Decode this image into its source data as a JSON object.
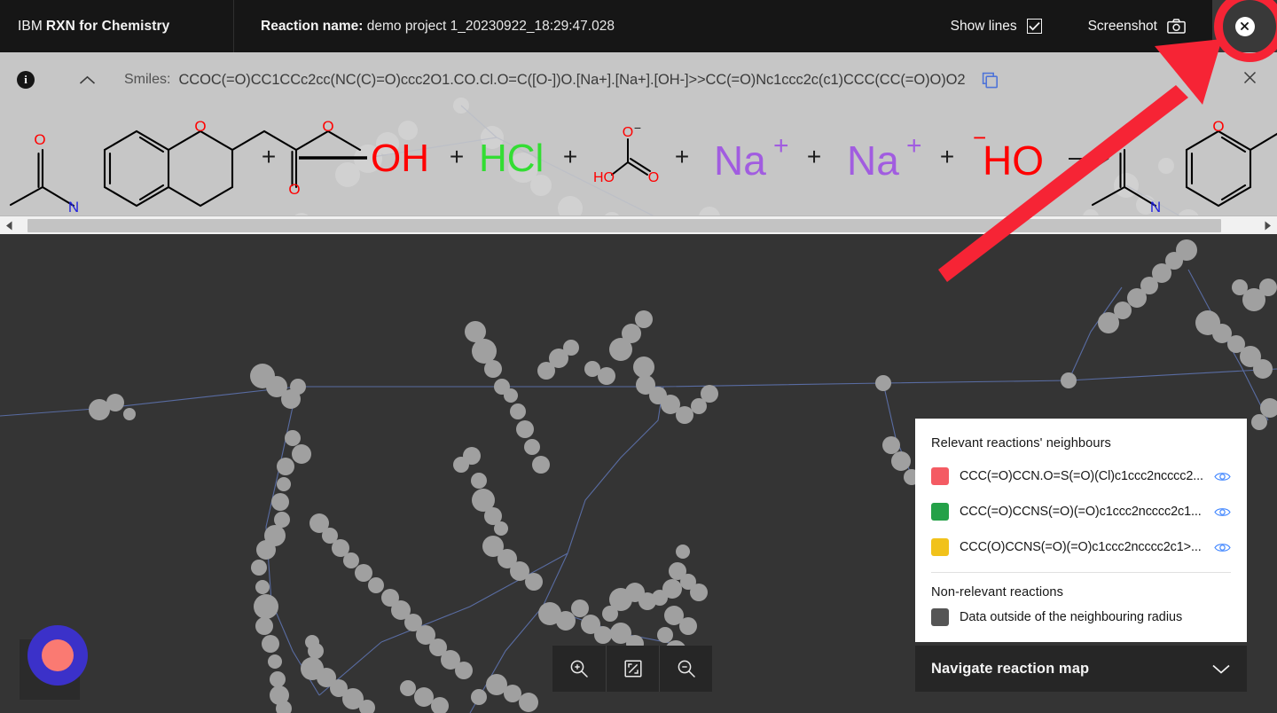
{
  "header": {
    "brand_light": "IBM",
    "brand_bold": "RXN for Chemistry",
    "reaction_label": "Reaction name:",
    "reaction_value": "demo project 1_20230922_18:29:47.028",
    "show_lines_label": "Show lines",
    "show_lines_checked": true,
    "screenshot_label": "Screenshot",
    "checkbox_icon": "check-icon",
    "camera_icon": "camera-icon",
    "close_icon": "close-circle-icon"
  },
  "smiles_panel": {
    "info_icon": "info-icon",
    "collapse_icon": "chevron-up-icon",
    "label": "Smiles:",
    "value": "CCOC(=O)CC1CCc2cc(NC(C)=O)ccc2O1.CO.Cl.O=C([O-])O.[Na+].[Na+].[OH-]>>CC(=O)Nc1ccc2c(c1)CCC(CC(=O)O)O2",
    "copy_icon": "copy-icon",
    "close_icon": "close-icon",
    "background": "#c6c6c6"
  },
  "reaction_drawing": {
    "reactants": [
      {
        "name": "ethyl 2-(6-acetamidochroman-2-yl)acetate",
        "render": "structure"
      },
      {
        "name": "methanol",
        "render": "line-OH",
        "label": "OH",
        "color": "#ff0000"
      },
      {
        "name": "hydrogen chloride",
        "render": "text",
        "label": "HCl",
        "color": "#33dd33"
      },
      {
        "name": "bicarbonate",
        "render": "structure",
        "labels": [
          "HO",
          "O",
          "O"
        ],
        "color": "#ff0000"
      },
      {
        "name": "sodium cation",
        "render": "text",
        "label": "Na",
        "charge": "+",
        "color": "#a15ce0"
      },
      {
        "name": "sodium cation",
        "render": "text",
        "label": "Na",
        "charge": "+",
        "color": "#a15ce0"
      },
      {
        "name": "hydroxide",
        "render": "text",
        "label": "HO",
        "charge": "−",
        "color": "#ff0000"
      }
    ],
    "plus_sign": "+",
    "arrow": "reaction-arrow",
    "products": [
      {
        "name": "2-(6-acetamidochroman-2-yl) product",
        "render": "structure"
      }
    ],
    "atom_colors": {
      "oxygen": "#ff0000",
      "nitrogen": "#2222dd",
      "carbon": "#000000"
    }
  },
  "scrollbar": {
    "left_arrow_icon": "triangle-left-icon",
    "right_arrow_icon": "triangle-right-icon"
  },
  "map": {
    "background": "#343434",
    "node_color": "#a0a0a0",
    "edge_color": "#5b6fa8",
    "cursor_icon": "crosshair-cursor",
    "marker": {
      "outer_color": "#3b31c9",
      "inner_color": "#fa7a72"
    }
  },
  "zoom_toolbar": {
    "buttons": [
      {
        "name": "zoom-in-button",
        "icon": "magnifier-plus-icon"
      },
      {
        "name": "fit-to-screen-button",
        "icon": "fit-screen-icon"
      },
      {
        "name": "zoom-out-button",
        "icon": "magnifier-minus-icon"
      }
    ]
  },
  "legend": {
    "title": "Relevant reactions' neighbours",
    "items": [
      {
        "color": "#f45b63",
        "text": "CCC(=O)CCN.O=S(=O)(Cl)c1ccc2ncccc2...",
        "eye_icon": "eye-icon"
      },
      {
        "color": "#24a148",
        "text": "CCC(=O)CCNS(=O)(=O)c1ccc2ncccc2c1...",
        "eye_icon": "eye-icon"
      },
      {
        "color": "#f1c21b",
        "text": "CCC(O)CCNS(=O)(=O)c1ccc2ncccc2c1>...",
        "eye_icon": "eye-icon"
      }
    ],
    "non_relevant_title": "Non-relevant reactions",
    "non_relevant_color": "#555555",
    "non_relevant_text": "Data outside of the neighbouring radius",
    "eye_color": "#4589ff"
  },
  "navigate_bar": {
    "title": "Navigate reaction map",
    "caret_icon": "chevron-down-icon"
  },
  "annotation": {
    "arrow_color": "#f62435",
    "highlight_circle_color": "#f62435",
    "type": "pointer-arrow-to-close-button"
  }
}
